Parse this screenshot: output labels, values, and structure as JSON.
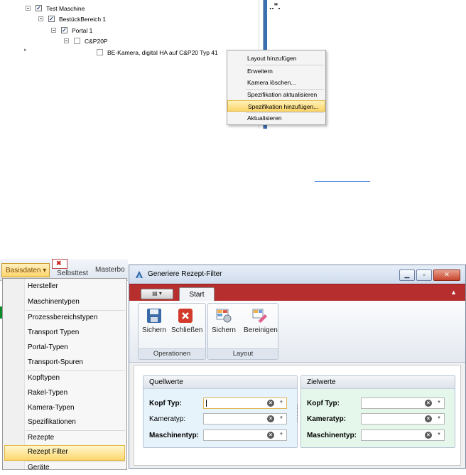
{
  "top": {
    "tree": [
      {
        "label": "Test Maschine",
        "checked": true
      },
      {
        "label": "BestückBereich 1",
        "checked": true
      },
      {
        "label": "Portal 1",
        "checked": true
      },
      {
        "label": "C&P20P",
        "checked": false
      },
      {
        "label": "BE-Kamera, digital HA auf C&P20 Typ 41",
        "checked": false
      }
    ],
    "side_text": "..\".",
    "context_menu": [
      {
        "label": "Layout hinzufügen"
      },
      {
        "label": "Erweitern"
      },
      {
        "label": "Kamera löschen..."
      },
      {
        "label": "Spezifikation aktualisieren"
      },
      {
        "label": "Spezifikation hinzufügen...",
        "active": true
      },
      {
        "label": "Aktualisieren"
      }
    ]
  },
  "left": {
    "ribbon_button": "Basisdaten ▾",
    "behind_labels": {
      "selbsttest": "Selbsttest",
      "masterbo": "Masterbo"
    },
    "menu": [
      "Hersteller",
      "Maschinentypen",
      "Prozessbereichstypen",
      "Transport Typen",
      "Portal-Typen",
      "Transport-Spuren",
      "Kopftypen",
      "Rakel-Typen",
      "Kamera-Typen",
      "Spezifikationen",
      "Rezepte",
      "Rezept Filter",
      "Geräte"
    ],
    "active_item": "Rezept Filter"
  },
  "dialog": {
    "title": "Generiere Rezept-Filter",
    "window_buttons": {
      "minimize": "▁",
      "maximize": "▫",
      "close": "✕"
    },
    "qat_label": "▤ ▾",
    "tab": "Start",
    "groups": [
      {
        "label": "Operationen",
        "buttons": [
          "Sichern",
          "Schließen"
        ]
      },
      {
        "label": "Layout",
        "buttons": [
          "Sichern",
          "Bereinigen"
        ]
      }
    ],
    "source_panel": {
      "title": "Quellwerte",
      "fields": [
        {
          "label": "Kopf Typ:",
          "value": ""
        },
        {
          "label": "Kameratyp:",
          "value": ""
        },
        {
          "label": "Maschinentyp:",
          "value": ""
        }
      ]
    },
    "target_panel": {
      "title": "Zielwerte",
      "fields": [
        {
          "label": "Kopf Typ:",
          "value": ""
        },
        {
          "label": "Kameratyp:",
          "value": ""
        },
        {
          "label": "Maschinentyp:",
          "value": ""
        }
      ]
    }
  }
}
